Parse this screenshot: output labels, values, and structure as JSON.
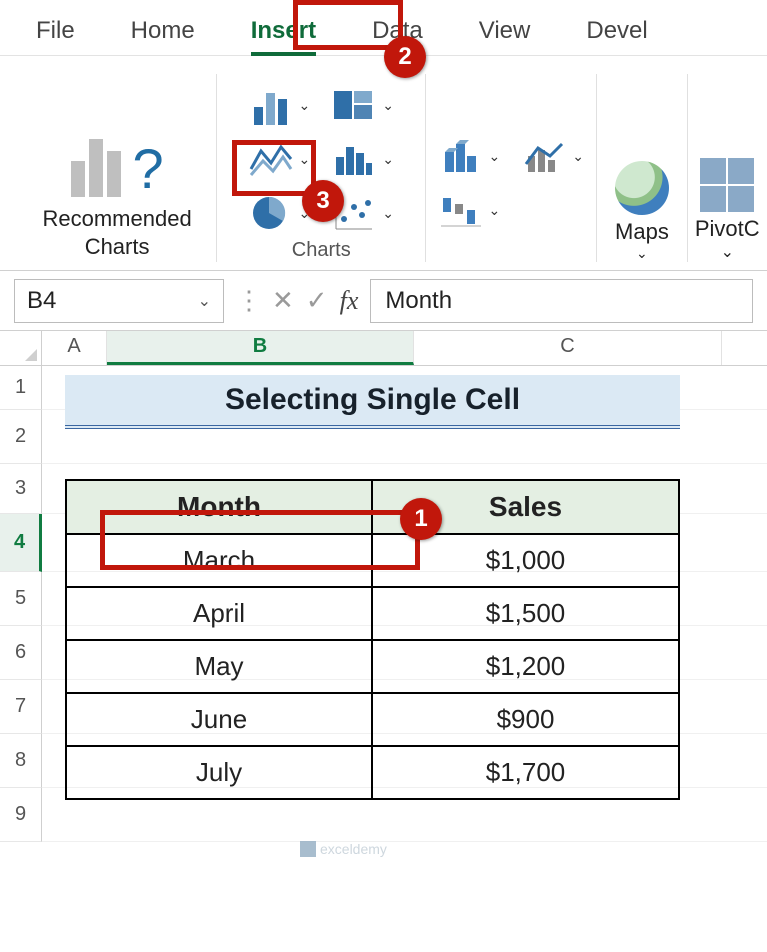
{
  "tabs": {
    "file": "File",
    "home": "Home",
    "insert": "Insert",
    "data": "Data",
    "view": "View",
    "developer": "Devel"
  },
  "ribbon": {
    "recommended_line1": "Recommended",
    "recommended_line2": "Charts",
    "group_charts_label": "Charts",
    "maps_label": "Maps",
    "pivot_label": "PivotC"
  },
  "formula_bar": {
    "name_box": "B4",
    "cancel": "✕",
    "enter": "✓",
    "fx": "fx",
    "content": "Month"
  },
  "columns": {
    "a": "A",
    "b": "B",
    "c": "C"
  },
  "row_nums": [
    "1",
    "2",
    "3",
    "4",
    "5",
    "6",
    "7",
    "8",
    "9"
  ],
  "title": "Selecting Single Cell",
  "table": {
    "headers": {
      "month": "Month",
      "sales": "Sales"
    },
    "rows": [
      {
        "month": "March",
        "sales": "$1,000"
      },
      {
        "month": "April",
        "sales": "$1,500"
      },
      {
        "month": "May",
        "sales": "$1,200"
      },
      {
        "month": "June",
        "sales": "$900"
      },
      {
        "month": "July",
        "sales": "$1,700"
      }
    ]
  },
  "badges": {
    "b1": "1",
    "b2": "2",
    "b3": "3"
  },
  "watermark": "exceldemy",
  "caret": "⌄"
}
